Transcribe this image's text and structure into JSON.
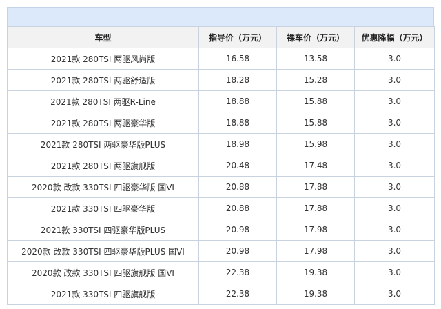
{
  "table": {
    "headers": [
      "车型",
      "指导价（万元）",
      "裸车价（万元）",
      "优惠降幅（万元）"
    ],
    "rows": [
      [
        "2021款 280TSI 两驱风尚版",
        "16.58",
        "13.58",
        "3.0"
      ],
      [
        "2021款 280TSI 两驱舒适版",
        "18.28",
        "15.28",
        "3.0"
      ],
      [
        "2021款 280TSI 两驱R-Line",
        "18.88",
        "15.88",
        "3.0"
      ],
      [
        "2021款 280TSI 两驱豪华版",
        "18.88",
        "15.88",
        "3.0"
      ],
      [
        "2021款 280TSI 两驱豪华版PLUS",
        "18.98",
        "15.98",
        "3.0"
      ],
      [
        "2021款 280TSI 两驱旗舰版",
        "20.48",
        "17.48",
        "3.0"
      ],
      [
        "2020款 改款 330TSI 四驱豪华版 国VI",
        "20.88",
        "17.88",
        "3.0"
      ],
      [
        "2021款 330TSI 四驱豪华版",
        "20.88",
        "17.88",
        "3.0"
      ],
      [
        "2021款 330TSI 四驱豪华版PLUS",
        "20.98",
        "17.98",
        "3.0"
      ],
      [
        "2020款 改款 330TSI 四驱豪华版PLUS 国VI",
        "20.98",
        "17.98",
        "3.0"
      ],
      [
        "2020款 改款 330TSI 四驱旗舰版 国VI",
        "22.38",
        "19.38",
        "3.0"
      ],
      [
        "2021款 330TSI 四驱旗舰版",
        "22.38",
        "19.38",
        "3.0"
      ]
    ]
  },
  "colors": {
    "caption_bar": "#dbe9fb",
    "header_bg": "#f2f2f2",
    "border": "#c9d3df"
  }
}
